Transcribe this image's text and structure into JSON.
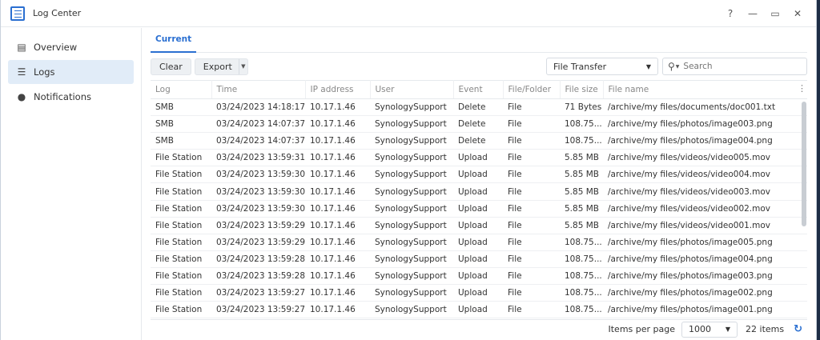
{
  "window": {
    "title": "Log Center",
    "controls": [
      "?",
      "—",
      "▭",
      "✕"
    ]
  },
  "sidebar": {
    "items": [
      {
        "label": "Overview",
        "icon": "overview-icon",
        "active": false
      },
      {
        "label": "Logs",
        "icon": "list-icon",
        "active": true
      },
      {
        "label": "Notifications",
        "icon": "chat-bubble-icon",
        "active": false
      }
    ]
  },
  "tabs": [
    {
      "label": "Current"
    }
  ],
  "toolbar": {
    "clear_label": "Clear",
    "export_label": "Export",
    "filter_value": "File Transfer",
    "search_placeholder": "Search"
  },
  "table": {
    "columns": [
      "Log",
      "Time",
      "IP address",
      "User",
      "Event",
      "File/Folder",
      "File size",
      "File name"
    ],
    "rows": [
      [
        "SMB",
        "03/24/2023 14:18:17",
        "10.17.1.46",
        "SynologySupport",
        "Delete",
        "File",
        "71 Bytes",
        "/archive/my files/documents/doc001.txt"
      ],
      [
        "SMB",
        "03/24/2023 14:07:37",
        "10.17.1.46",
        "SynologySupport",
        "Delete",
        "File",
        "108.75...",
        "/archive/my files/photos/image003.png"
      ],
      [
        "SMB",
        "03/24/2023 14:07:37",
        "10.17.1.46",
        "SynologySupport",
        "Delete",
        "File",
        "108.75...",
        "/archive/my files/photos/image004.png"
      ],
      [
        "File Station",
        "03/24/2023 13:59:31",
        "10.17.1.46",
        "SynologySupport",
        "Upload",
        "File",
        "5.85 MB",
        "/archive/my files/videos/video005.mov"
      ],
      [
        "File Station",
        "03/24/2023 13:59:30",
        "10.17.1.46",
        "SynologySupport",
        "Upload",
        "File",
        "5.85 MB",
        "/archive/my files/videos/video004.mov"
      ],
      [
        "File Station",
        "03/24/2023 13:59:30",
        "10.17.1.46",
        "SynologySupport",
        "Upload",
        "File",
        "5.85 MB",
        "/archive/my files/videos/video003.mov"
      ],
      [
        "File Station",
        "03/24/2023 13:59:30",
        "10.17.1.46",
        "SynologySupport",
        "Upload",
        "File",
        "5.85 MB",
        "/archive/my files/videos/video002.mov"
      ],
      [
        "File Station",
        "03/24/2023 13:59:29",
        "10.17.1.46",
        "SynologySupport",
        "Upload",
        "File",
        "5.85 MB",
        "/archive/my files/videos/video001.mov"
      ],
      [
        "File Station",
        "03/24/2023 13:59:29",
        "10.17.1.46",
        "SynologySupport",
        "Upload",
        "File",
        "108.75...",
        "/archive/my files/photos/image005.png"
      ],
      [
        "File Station",
        "03/24/2023 13:59:28",
        "10.17.1.46",
        "SynologySupport",
        "Upload",
        "File",
        "108.75...",
        "/archive/my files/photos/image004.png"
      ],
      [
        "File Station",
        "03/24/2023 13:59:28",
        "10.17.1.46",
        "SynologySupport",
        "Upload",
        "File",
        "108.75...",
        "/archive/my files/photos/image003.png"
      ],
      [
        "File Station",
        "03/24/2023 13:59:27",
        "10.17.1.46",
        "SynologySupport",
        "Upload",
        "File",
        "108.75...",
        "/archive/my files/photos/image002.png"
      ],
      [
        "File Station",
        "03/24/2023 13:59:27",
        "10.17.1.46",
        "SynologySupport",
        "Upload",
        "File",
        "108.75...",
        "/archive/my files/photos/image001.png"
      ]
    ]
  },
  "pager": {
    "label": "Items per page",
    "per_page": "1000",
    "count": "22 items"
  },
  "colors": {
    "accent": "#2a6fd1",
    "active_bg": "#e1ecf8"
  }
}
